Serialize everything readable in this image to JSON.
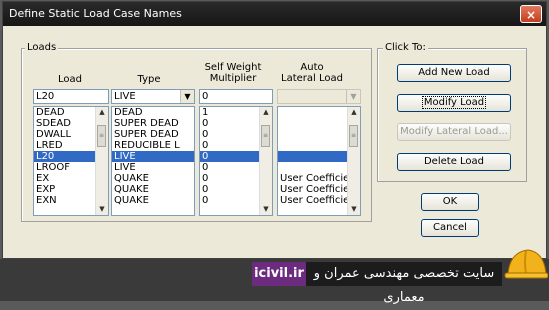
{
  "window": {
    "title": "Define Static Load Case Names",
    "close_glyph": "×"
  },
  "loads_group": {
    "label": "Loads",
    "headers": {
      "load": "Load",
      "type": "Type",
      "self_weight": "Self Weight\nMultiplier",
      "auto_lateral": "Auto\nLateral Load"
    },
    "inputs": {
      "load": "L20",
      "type": "LIVE",
      "self_weight": "0",
      "auto_lateral": ""
    },
    "rows": [
      {
        "load": "DEAD",
        "type": "DEAD",
        "mult": "1",
        "lateral": ""
      },
      {
        "load": "SDEAD",
        "type": "SUPER DEAD",
        "mult": "0",
        "lateral": ""
      },
      {
        "load": "DWALL",
        "type": "SUPER DEAD",
        "mult": "0",
        "lateral": ""
      },
      {
        "load": "LRED",
        "type": "REDUCIBLE L",
        "mult": "0",
        "lateral": ""
      },
      {
        "load": "L20",
        "type": "LIVE",
        "mult": "0",
        "lateral": "",
        "selected": true
      },
      {
        "load": "LROOF",
        "type": "LIVE",
        "mult": "0",
        "lateral": ""
      },
      {
        "load": "EX",
        "type": "QUAKE",
        "mult": "0",
        "lateral": "User Coefficier"
      },
      {
        "load": "EXP",
        "type": "QUAKE",
        "mult": "0",
        "lateral": "User Coefficier"
      },
      {
        "load": "EXN",
        "type": "QUAKE",
        "mult": "0",
        "lateral": "User Coefficier"
      }
    ]
  },
  "click_group": {
    "label": "Click To:",
    "add": "Add New Load",
    "modify": "Modify Load",
    "modify_lateral": "Modify Lateral Load...",
    "delete": "Delete Load"
  },
  "buttons": {
    "ok": "OK",
    "cancel": "Cancel"
  },
  "banner": {
    "site": "icivil.ir",
    "text": "سایت تخصصی مهندسی عمران و معماری"
  }
}
